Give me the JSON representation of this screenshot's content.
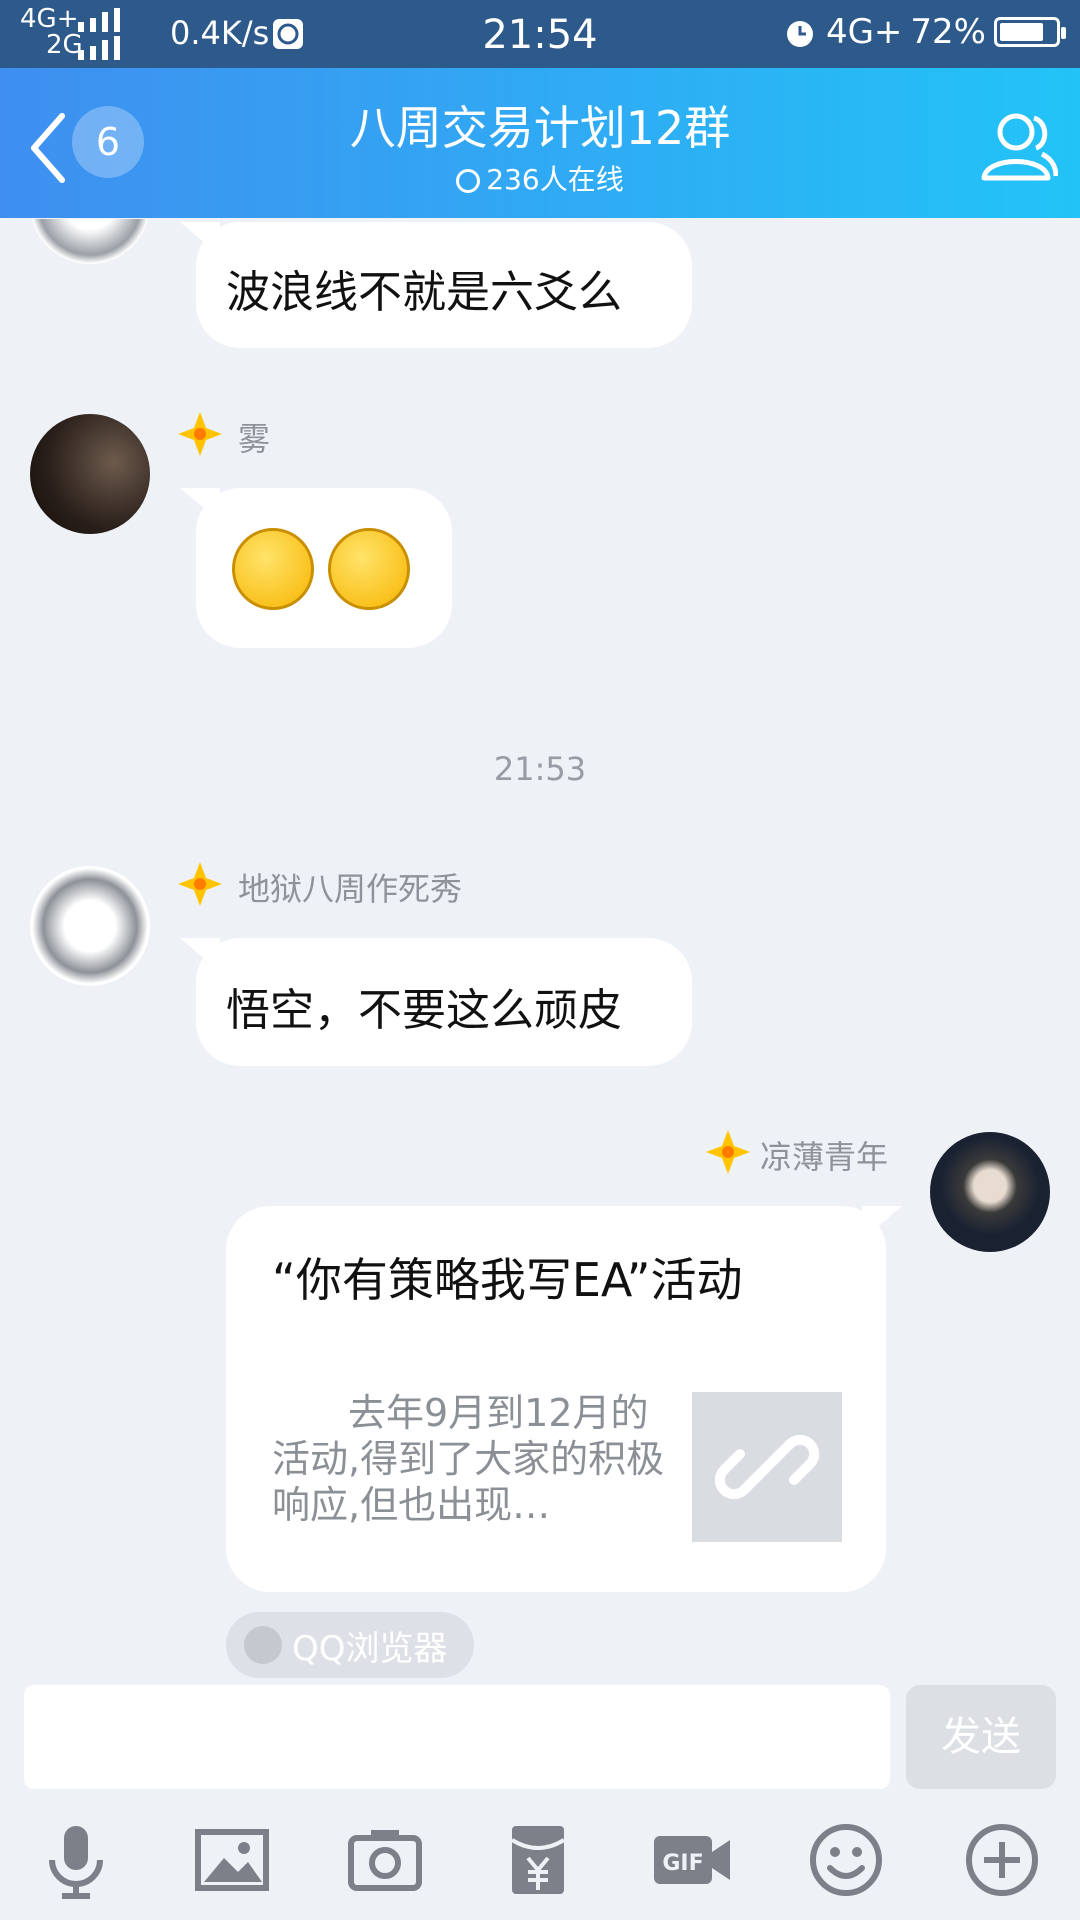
{
  "status": {
    "network_top": "4G+",
    "network_bottom": "2G",
    "speed": "0.4K/s",
    "time": "21:54",
    "network_right": "4G+",
    "battery": "72%"
  },
  "header": {
    "unread_count": "6",
    "title": "八周交易计划12群",
    "online": "236人在线"
  },
  "messages": [
    {
      "text": "波浪线不就是六爻么"
    },
    {
      "sender": "雾",
      "emoji": [
        "smirk-face-emoji",
        "smirk-face-emoji"
      ]
    },
    {
      "timestamp": "21:53"
    },
    {
      "sender": "地狱八周作死秀",
      "text": "悟空，不要这么顽皮"
    },
    {
      "sender": "凉薄青年",
      "card_title": "“你有策略我写EA”活动",
      "card_desc": "　　去年9月到12月的活动,得到了大家的积极响应,但也出现…",
      "source": "QQ浏览器"
    }
  ],
  "input": {
    "send_label": "发送"
  },
  "toolbar": [
    "microphone-icon",
    "image-icon",
    "camera-icon",
    "red-packet-icon",
    "gif-icon",
    "emoji-icon",
    "plus-icon"
  ],
  "colors": {
    "header_start": "#3f8ff0",
    "header_end": "#22c3f7",
    "background": "#eef1f6",
    "status_bar": "#2d5a8a"
  }
}
